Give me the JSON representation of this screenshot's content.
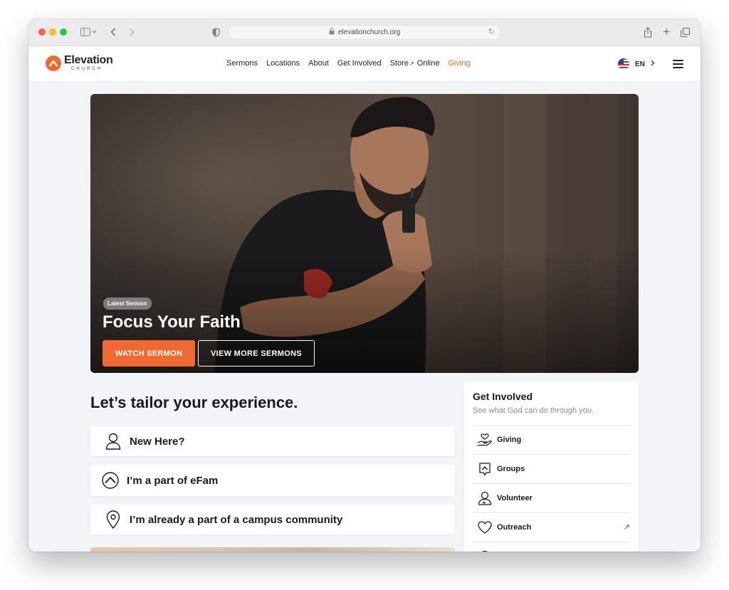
{
  "browser": {
    "url": "elevationchurch.org"
  },
  "header": {
    "logo_name": "Elevation",
    "logo_sub": "CHURCH",
    "nav": [
      {
        "label": "Sermons"
      },
      {
        "label": "Locations"
      },
      {
        "label": "About"
      },
      {
        "label": "Get Involved"
      },
      {
        "label": "Store",
        "external": "↗"
      },
      {
        "label": "Online"
      },
      {
        "label": "Giving"
      }
    ],
    "language": "EN",
    "accent_color": "#f0682f"
  },
  "hero": {
    "badge": "Latest Sermon",
    "title": "Focus Your Faith",
    "watch_label": "WATCH SERMON",
    "more_label": "VIEW MORE SERMONS"
  },
  "tailor": {
    "title": "Let’s tailor your experience.",
    "options": [
      {
        "label": "New Here?",
        "icon": "person-icon"
      },
      {
        "label": "I’m a part of eFam",
        "icon": "elevation-logo-icon"
      },
      {
        "label": "I’m already a part of a campus community",
        "icon": "location-pin-icon"
      }
    ]
  },
  "involved": {
    "title": "Get Involved",
    "subtitle": "See what God can do through you.",
    "items": [
      {
        "label": "Giving",
        "icon": "hand-heart-icon"
      },
      {
        "label": "Groups",
        "icon": "groups-chat-icon"
      },
      {
        "label": "Volunteer",
        "icon": "volunteer-icon"
      },
      {
        "label": "Outreach",
        "icon": "heart-icon",
        "external": "↗"
      }
    ]
  }
}
